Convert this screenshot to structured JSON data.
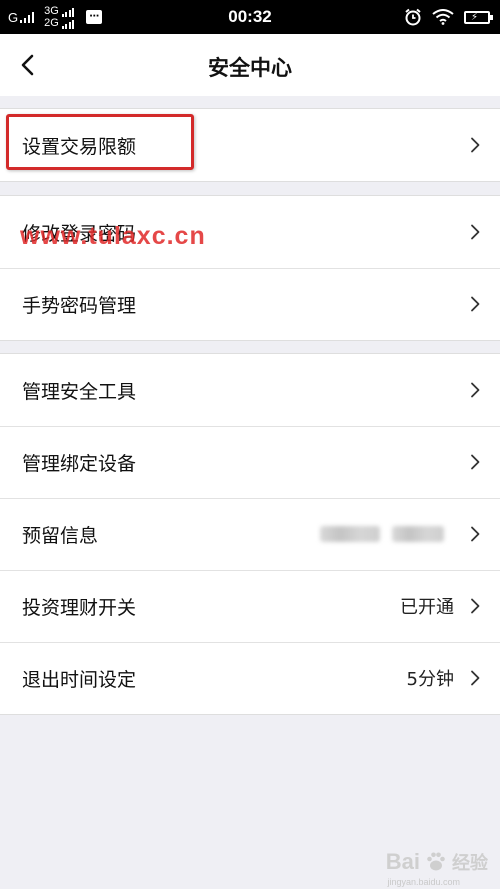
{
  "status_bar": {
    "carrier": "G",
    "net_top": "3G",
    "net_bottom": "2G",
    "time": "00:32"
  },
  "header": {
    "title": "安全中心",
    "back_icon": "chevron-left-icon"
  },
  "groups": [
    {
      "items": [
        {
          "label": "设置交易限额",
          "value": ""
        }
      ]
    },
    {
      "items": [
        {
          "label": "修改登录密码",
          "value": ""
        },
        {
          "label": "手势密码管理",
          "value": ""
        }
      ]
    },
    {
      "items": [
        {
          "label": "管理安全工具",
          "value": ""
        },
        {
          "label": "管理绑定设备",
          "value": ""
        },
        {
          "label": "预留信息",
          "value": ""
        },
        {
          "label": "投资理财开关",
          "value": "已开通"
        },
        {
          "label": "退出时间设定",
          "value": "5分钟"
        }
      ]
    }
  ],
  "overlays": {
    "watermark": "www.tulaxc.cn",
    "baidu_logo": "Bai",
    "baidu_suffix": "经验",
    "baidu_url": "jingyan.baidu.com",
    "highlight_color": "#d32a2a"
  },
  "colors": {
    "background": "#efeff4",
    "card": "#ffffff",
    "status_bar": "#000000"
  }
}
